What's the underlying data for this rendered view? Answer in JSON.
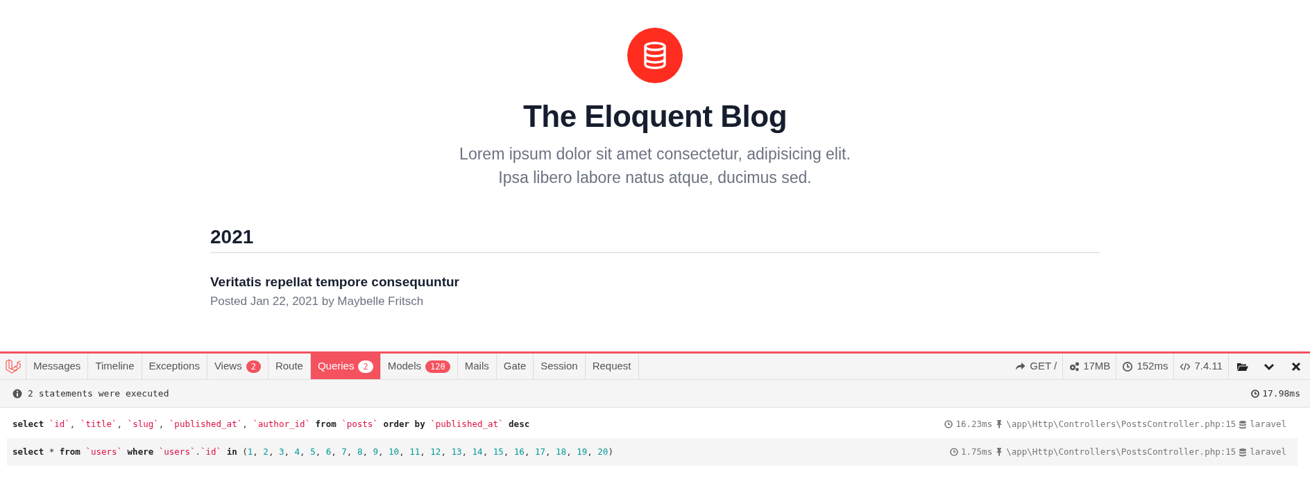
{
  "blog": {
    "title": "The Eloquent Blog",
    "subtitle_lines": [
      "Lorem ipsum dolor sit amet consectetur, adipisicing elit.",
      "Ipsa libero labore natus atque, ducimus sed."
    ]
  },
  "year_groups": [
    {
      "year": "2021",
      "posts": [
        {
          "title": "Veritatis repellat tempore consequuntur",
          "meta": "Posted Jan 22, 2021 by Maybelle Fritsch"
        }
      ]
    }
  ],
  "debugbar": {
    "tabs": [
      {
        "label": "Messages",
        "selected": false
      },
      {
        "label": "Timeline",
        "selected": false
      },
      {
        "label": "Exceptions",
        "selected": false
      },
      {
        "label": "Views",
        "badge": "2",
        "selected": false
      },
      {
        "label": "Route",
        "selected": false
      },
      {
        "label": "Queries",
        "badge": "2",
        "selected": true
      },
      {
        "label": "Models",
        "badge": "120",
        "selected": false
      },
      {
        "label": "Mails",
        "selected": false
      },
      {
        "label": "Gate",
        "selected": false
      },
      {
        "label": "Session",
        "selected": false
      },
      {
        "label": "Request",
        "selected": false
      }
    ],
    "status_items": [
      {
        "kind": "request",
        "text": "GET /"
      },
      {
        "kind": "memory",
        "text": "17MB"
      },
      {
        "kind": "time",
        "text": "152ms"
      },
      {
        "kind": "version",
        "text": "7.4.11"
      }
    ],
    "actions": [
      {
        "kind": "open"
      },
      {
        "kind": "minimize"
      },
      {
        "kind": "close"
      }
    ],
    "queries": {
      "summary": "2 statements were executed",
      "total_time": "17.98ms",
      "statements": [
        {
          "sql": "select `id`, `title`, `slug`, `published_at`, `author_id` from `posts` order by `published_at` desc",
          "duration": "16.23ms",
          "source": "\\app\\Http\\Controllers\\PostsController.php:15",
          "connection": "laravel"
        },
        {
          "sql": "select * from `users` where `users`.`id` in (1, 2, 3, 4, 5, 6, 7, 8, 9, 10, 11, 12, 13, 14, 15, 16, 17, 18, 19, 20)",
          "duration": "1.75ms",
          "source": "\\app\\Http\\Controllers\\PostsController.php:15",
          "connection": "laravel"
        }
      ]
    }
  }
}
